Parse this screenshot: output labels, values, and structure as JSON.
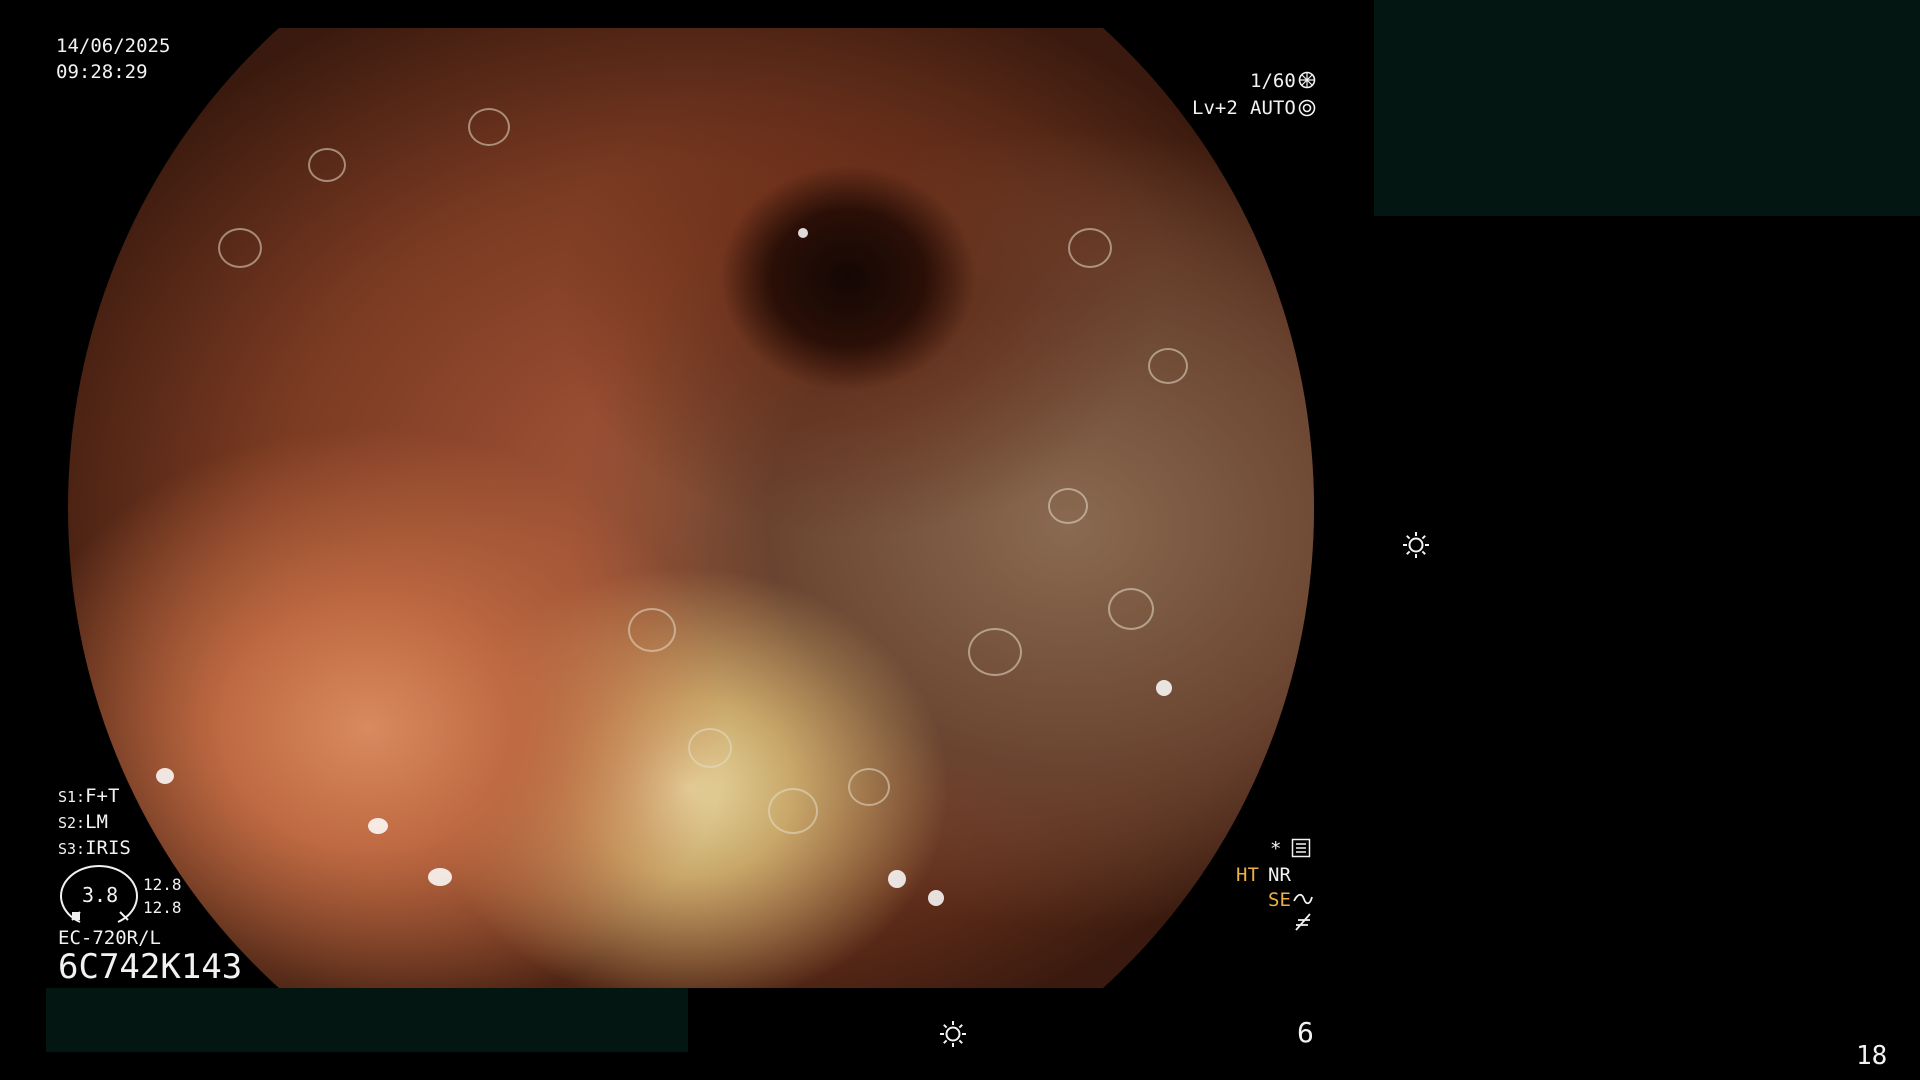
{
  "overlay": {
    "date": "14/06/2025",
    "time": "09:28:29",
    "shutter": "1/60",
    "level": "Lv+2",
    "mode": "AUTO",
    "s1_key": "S1:",
    "s1_value": "F+T",
    "s2_key": "S2:",
    "s2_value": "LM",
    "s3_key": "S3:",
    "s3_value": "IRIS",
    "gauge_value": "3.8",
    "gauge_top": "12.8",
    "gauge_bottom": "12.8",
    "scope_model": "EC-720R/L",
    "serial": "6C742K143",
    "star": "*",
    "ht": "HT",
    "nr": "NR",
    "se": "SE",
    "bottom_number": "6",
    "corner_number": "18"
  },
  "colors": {
    "accent_orange": "#f0b040",
    "redaction": "#031612"
  },
  "icons": [
    "aperture-icon",
    "iris-icon",
    "settings-panel-icon",
    "wave-icon",
    "slash-icon",
    "brightness-icon"
  ]
}
